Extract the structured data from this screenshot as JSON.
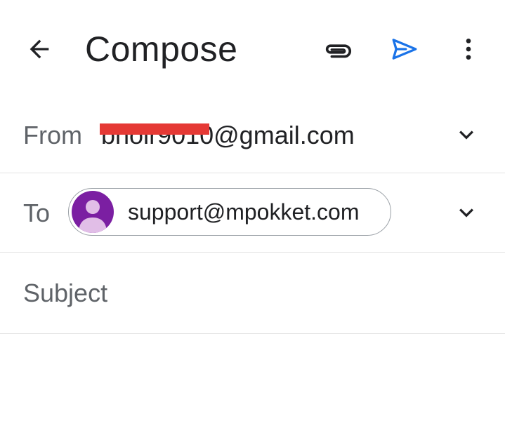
{
  "appbar": {
    "title": "Compose",
    "icons": {
      "back": "arrow-back-icon",
      "attach": "paperclip-icon",
      "send": "send-icon",
      "more": "more-vert-icon"
    },
    "send_color": "#1a73e8"
  },
  "from": {
    "label": "From",
    "value": "bhoir9010@gmail.com",
    "redacted": true,
    "redaction_color": "#e53935"
  },
  "to": {
    "label": "To",
    "chip_email": "support@mpokket.com",
    "avatar_color": "#7b1fa2"
  },
  "subject": {
    "placeholder": "Subject",
    "value": ""
  },
  "body": {
    "value": ""
  }
}
